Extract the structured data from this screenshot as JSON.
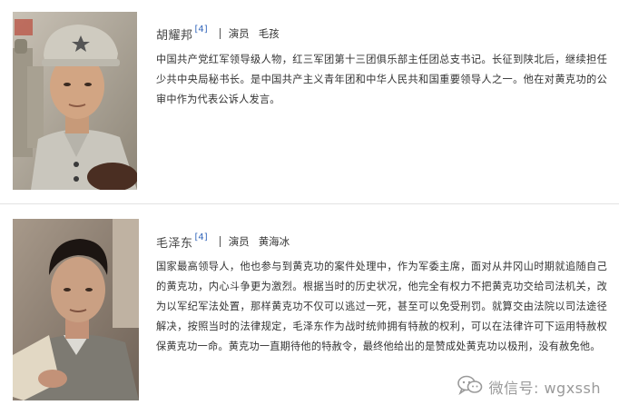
{
  "characters": [
    {
      "name": "胡耀邦",
      "ref": "[4]",
      "role_label": "演员",
      "actor": "毛孩",
      "description": "中国共产党红军领导级人物，红三军团第十三团俱乐部主任团总支书记。长征到陕北后，继续担任少共中央局秘书长。是中国共产主义青年团和中华人民共和国重要领导人之一。他在对黄克功的公审中作为代表公诉人发言。"
    },
    {
      "name": "毛泽东",
      "ref": "[4]",
      "role_label": "演员",
      "actor": "黄海冰",
      "description": "国家最高领导人，他也参与到黄克功的案件处理中，作为军委主席，面对从井冈山时期就追随自己的黄克功，内心斗争更为激烈。根据当时的历史状况，他完全有权力不把黄克功交给司法机关，改为以军纪军法处置，那样黄克功不仅可以逃过一死，甚至可以免受刑罚。就算交由法院以司法途径解决，按照当时的法律规定，毛泽东作为战时统帅拥有特赦的权利，可以在法律许可下运用特赦权保黄克功一命。黄克功一直期待他的特赦令，最终他给出的是赞成处黄克功以极刑，没有赦免他。"
    }
  ],
  "watermark": {
    "icon": "wechat-icon",
    "text": "微信号: wgxssh"
  },
  "colors": {
    "divider": "#e3e3e3",
    "ref_link": "#3366bb",
    "watermark": "#9a9a9a"
  }
}
